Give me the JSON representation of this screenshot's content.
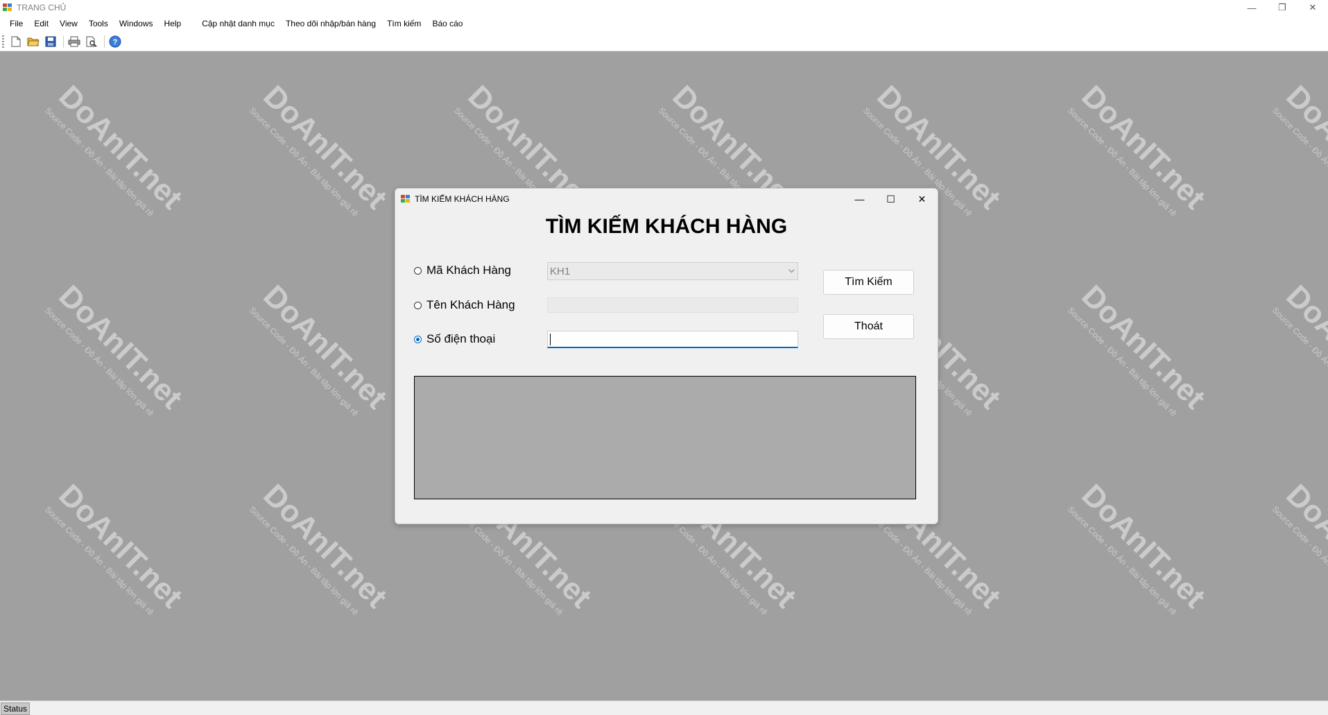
{
  "window": {
    "title": "TRANG CHỦ"
  },
  "window_controls": {
    "minimize": "—",
    "restore": "❐",
    "close": "✕"
  },
  "menubar": {
    "items": [
      "File",
      "Edit",
      "View",
      "Tools",
      "Windows",
      "Help",
      "Cập nhật danh mục",
      "Theo dõi nhập/bán hàng",
      "Tìm kiếm",
      "Báo cáo"
    ]
  },
  "toolbar": {
    "buttons": [
      "new-icon",
      "open-folder-icon",
      "save-icon",
      "print-icon",
      "print-preview-icon",
      "help-icon"
    ]
  },
  "watermark": {
    "brand": "DoAnIT.net",
    "tagline": "Source Code - Đồ Án - Bài tập lớn giá rẻ"
  },
  "dialog": {
    "title": "TÌM KIẾM KHÁCH HÀNG",
    "heading": "TÌM KIẾM KHÁCH HÀNG",
    "controls": {
      "minimize": "—",
      "maximize": "☐",
      "close": "✕"
    },
    "options": [
      {
        "label": "Mã Khách Hàng",
        "checked": false
      },
      {
        "label": "Tên Khách Hàng",
        "checked": false
      },
      {
        "label": "Số điện thoại",
        "checked": true
      }
    ],
    "customer_code_value": "KH1",
    "customer_name_value": "",
    "phone_value": "",
    "search_button": "Tìm Kiếm",
    "exit_button": "Thoát"
  },
  "statusbar": {
    "label": "Status"
  },
  "colors": {
    "accent": "#0067c0",
    "mdi_background": "#a0a0a0",
    "grid_background": "#ababab"
  }
}
